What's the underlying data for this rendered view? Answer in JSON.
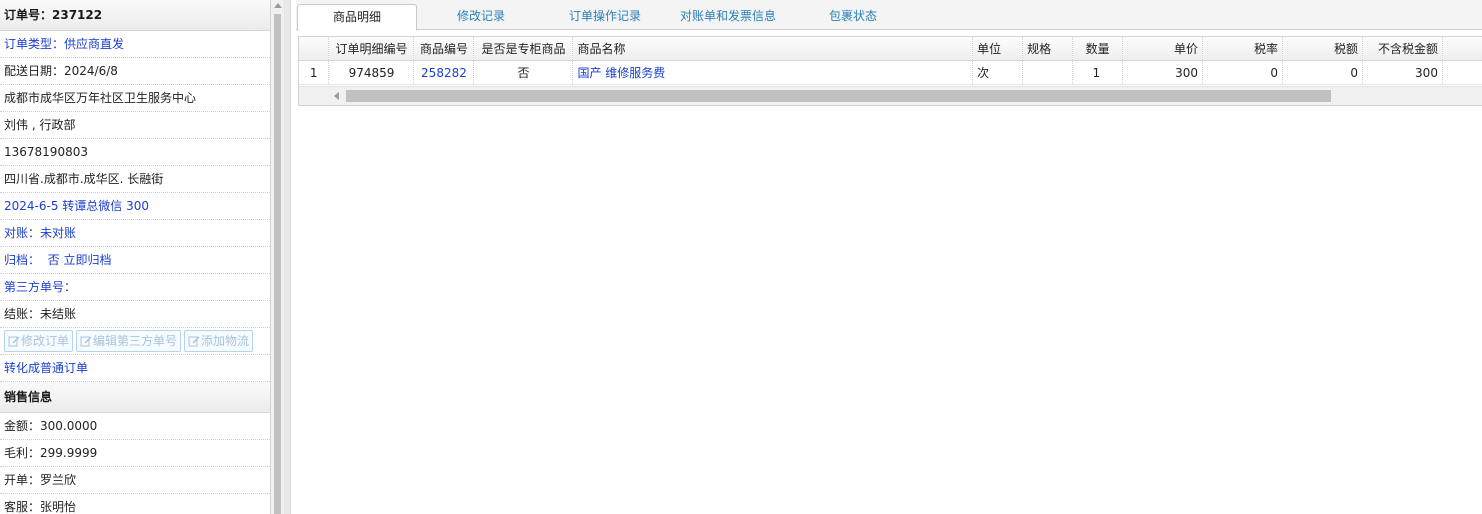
{
  "order": {
    "number": "订单号：237122",
    "type": "订单类型：供应商直发",
    "delivery_date": "配送日期：2024/6/8",
    "address_org": "成都市成华区万年社区卫生服务中心",
    "contact": "刘伟 , 行政部",
    "phone": "13678190803",
    "address": "四川省.成都市.成华区. 长融街",
    "remark": "2024-6-5 转谭总微信 300",
    "reconcile": "对账：未对账",
    "archive": "归档：  否 立即归档",
    "third_party": "第三方单号：",
    "settlement": "结账：未结账",
    "buttons": [
      "修改订单",
      "编辑第三方单号",
      "添加物流"
    ],
    "convert": "转化成普通订单"
  },
  "sales": {
    "header": "销售信息",
    "amount": "金额：300.0000",
    "profit": "毛利：299.9999",
    "opener": "开单：罗兰欣",
    "service": "客服：张明怡"
  },
  "tabs": [
    "商品明细",
    "修改记录",
    "订单操作记录",
    "对账单和发票信息",
    "包裹状态"
  ],
  "grid": {
    "columns": [
      "",
      "订单明细编号",
      "商品编号",
      "是否是专柜商品",
      "商品名称",
      "单位",
      "规格",
      "数量",
      "单价",
      "税率",
      "税额",
      "不含税金额"
    ],
    "rows": [
      [
        "1",
        "974859",
        "258282",
        "否",
        "国产 维修服务费",
        "次",
        "",
        "1",
        "300",
        "0",
        "0",
        "300"
      ]
    ]
  },
  "colors": {
    "link": "#1a3fd0",
    "tab_link": "#2a7fb8",
    "disabled_button": "#a8c4dc"
  }
}
